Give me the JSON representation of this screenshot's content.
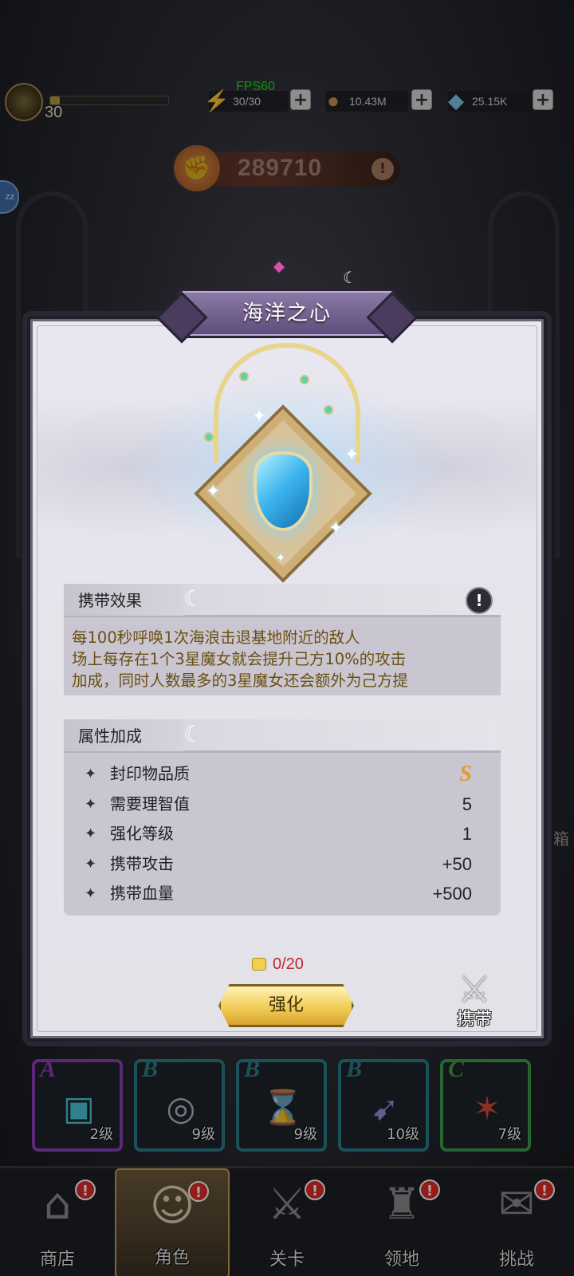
{
  "hud": {
    "fps": "FPS60",
    "level": "30",
    "energy": "30/30",
    "gold": "10.43M",
    "gems": "25.15K",
    "power": "289710",
    "xp_fraction": 0.08
  },
  "modal": {
    "title": "海洋之心",
    "effect_section": {
      "label": "携带效果",
      "lines": [
        "每100秒呼唤1次海浪击退基地附近的敌人",
        "场上每存在1个3星魔女就会提升己方10%的攻击",
        "加成，同时人数最多的3星魔女还会额外为己方提"
      ]
    },
    "attr_section": {
      "label": "属性加成",
      "rows": [
        {
          "label": "封印物品质",
          "value": "S"
        },
        {
          "label": "需要理智值",
          "value": "5"
        },
        {
          "label": "强化等级",
          "value": "1"
        },
        {
          "label": "携带攻击",
          "value": "+50"
        },
        {
          "label": "携带血量",
          "value": "+500"
        }
      ]
    },
    "cost": "0/20",
    "enhance_label": "强化",
    "carry_label": "携带"
  },
  "slots": [
    {
      "grade": "A",
      "level": "2级",
      "color": "#8b3fb8"
    },
    {
      "grade": "B",
      "level": "9级",
      "color": "#2c7d8a"
    },
    {
      "grade": "B",
      "level": "9级",
      "color": "#2c7d8a"
    },
    {
      "grade": "B",
      "level": "10级",
      "color": "#2c7d8a"
    },
    {
      "grade": "C",
      "level": "7级",
      "color": "#3e9a4a"
    }
  ],
  "nav": [
    {
      "label": "商店",
      "badge": "!"
    },
    {
      "label": "角色",
      "badge": "!"
    },
    {
      "label": "关卡",
      "badge": "!"
    },
    {
      "label": "领地",
      "badge": "!"
    },
    {
      "label": "挑战",
      "badge": "!"
    }
  ],
  "side_text": "箱"
}
